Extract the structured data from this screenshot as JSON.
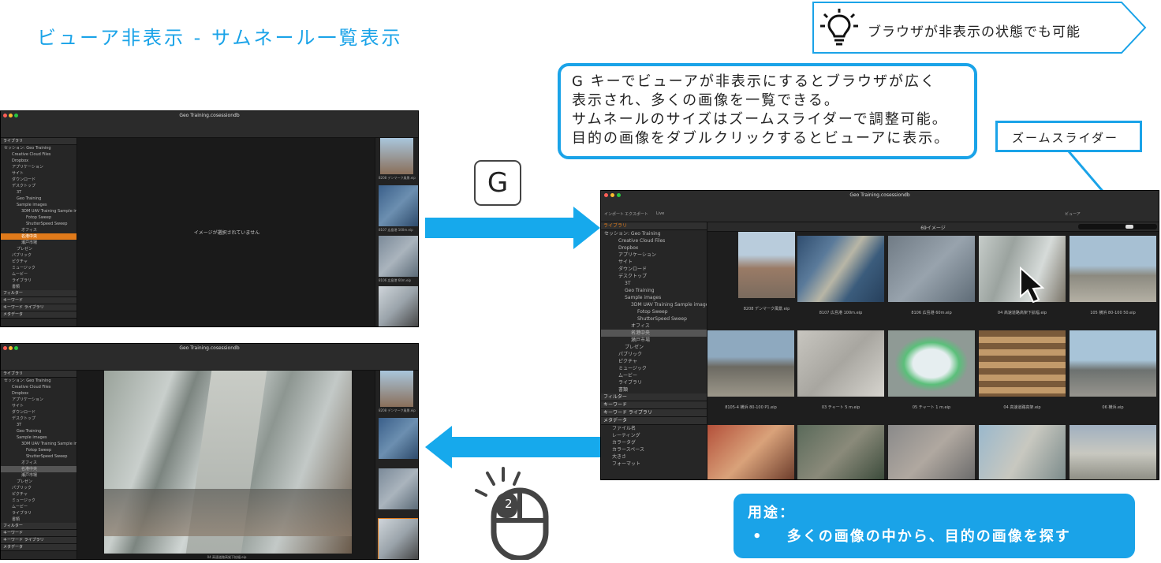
{
  "title": "ビューア非表示 - サムネール一覧表示",
  "tip": {
    "icon": "lightbulb-icon",
    "text": "ブラウザが非表示の状態でも可能"
  },
  "callout": {
    "lines": [
      "G キーでビューアが非表示にするとブラウザが広く",
      "表示され、多くの画像を一覧できる。",
      "サムネールのサイズはズームスライダーで調整可能。",
      "目的の画像をダブルクリックするとビューアに表示。"
    ]
  },
  "zoom_label": "ズームスライダー",
  "gkey": "G",
  "mouse": {
    "icon": "mouse-double-click-icon",
    "clicks": "2"
  },
  "usage": {
    "head": "用途：",
    "bullet": "•",
    "item": "多くの画像の中から、目的の画像を探す"
  },
  "colors": {
    "accent": "#1aa3e8",
    "select": "#e07a1a"
  },
  "app": {
    "window_title": "Geo Training.cosessiondb",
    "no_image": "イメージが選択されていません",
    "image_count": "69イメージ",
    "toolbar_items": [
      "インポート",
      "エクスポート",
      "Live",
      "リセット",
      "取り消し/やり直し",
      "オート調整",
      "ビューア",
      "グリッド",
      "露出警告",
      "焦点",
      "コピー/適用"
    ],
    "tabs": [
      "ライブラリ",
      "フィルター",
      "キーワード",
      "キーワード ライブラリ",
      "メタデータ"
    ],
    "session_label": "セッション: Geo Training",
    "tree": [
      "Creative Cloud Files",
      "Dropbox",
      "アプリケーション",
      "サイト",
      "ダウンロード",
      "デスクトップ",
      "3T",
      "Geo Training",
      "Sample images",
      "3DM UAV Training Sample images",
      "Fotop Sweep",
      "ShutterSpeed Sweep",
      "オフィス",
      "名港中央",
      "瀬戸市場",
      "プレゼン",
      "パブリック",
      "ピクチャ",
      "ミュージック",
      "ムービー",
      "ライブラリ",
      "書類"
    ],
    "meta_rows": [
      "ファイル名",
      "レーティング",
      "カラータグ",
      "カラースペース",
      "大きさ",
      "フォーマット"
    ],
    "viewer_caption": "04 高速道路高架下拡幅.eip",
    "grid_captions": [
      "8208 デンマーク風景.eip",
      "8107 広島港 100m.eip",
      "8106 広島港 60m.eip",
      "04 高速道路高架下拡幅.eip",
      "105 横浜 80-100 50.eip",
      "8105-4 横浜 80-100 P1.eip",
      "03 チャート 5 m.eip",
      "05 チャート 1 m.eip",
      "04 高速道路高架.eip",
      "06 横浜.eip"
    ]
  }
}
